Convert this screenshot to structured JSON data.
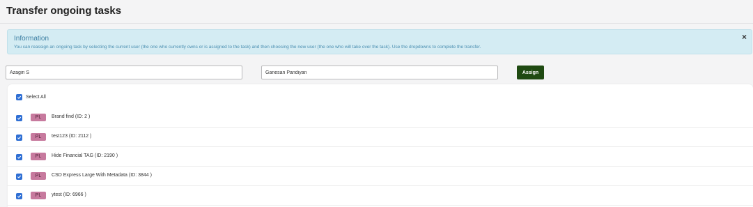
{
  "page": {
    "title": "Transfer ongoing tasks"
  },
  "info": {
    "title": "Information",
    "text": "You can reassign an ongoing task by selecting the current user (the one who currently owns or is assigned to the task) and then choosing the new user (the one who will take over the task). Use the dropdowns to complete the transfer.",
    "close_symbol": "×"
  },
  "transfer": {
    "current_user": "Azagiri S",
    "new_user": "Ganesan Pandiyan",
    "assign_label": "Assign"
  },
  "tasks": {
    "select_all_label": "Select All",
    "select_all_checked": true,
    "items": [
      {
        "badge": "PL",
        "label": "Brand find (ID: 2 )",
        "checked": true
      },
      {
        "badge": "PL",
        "label": "test123 (ID: 2112 )",
        "checked": true
      },
      {
        "badge": "PL",
        "label": "Hide Financial TAG (ID: 2190 )",
        "checked": true
      },
      {
        "badge": "PL",
        "label": "CSD Express Large With Metadata (ID: 3844 )",
        "checked": true
      },
      {
        "badge": "PL",
        "label": "ytest (ID: 6966 )",
        "checked": true
      }
    ]
  },
  "colors": {
    "info_bg": "#d4ecf3",
    "info_text": "#3c7fa3",
    "assign_button": "#1f4a12",
    "badge_bg": "#c77a9e",
    "checkbox": "#2f6fd4"
  },
  "icons": {
    "close": "close-icon",
    "checkbox": "checkmark-icon"
  }
}
